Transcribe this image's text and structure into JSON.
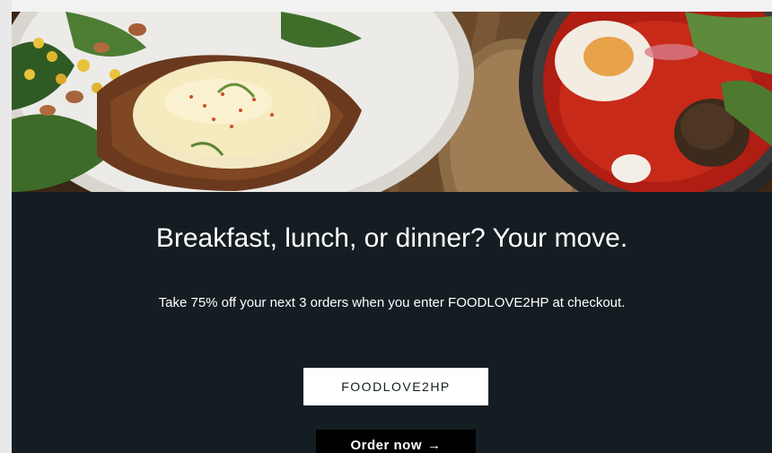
{
  "promo": {
    "headline": "Breakfast, lunch, or dinner? Your move.",
    "subtext": "Take 75% off your next 3 orders when you enter FOODLOVE2HP at checkout.",
    "promo_code": "FOODLOVE2HP",
    "order_button_label": "Order now",
    "order_button_icon": "arrow-right-icon"
  },
  "colors": {
    "promo_background": "#141d22",
    "button_background": "#000000",
    "code_box_background": "#ffffff"
  }
}
